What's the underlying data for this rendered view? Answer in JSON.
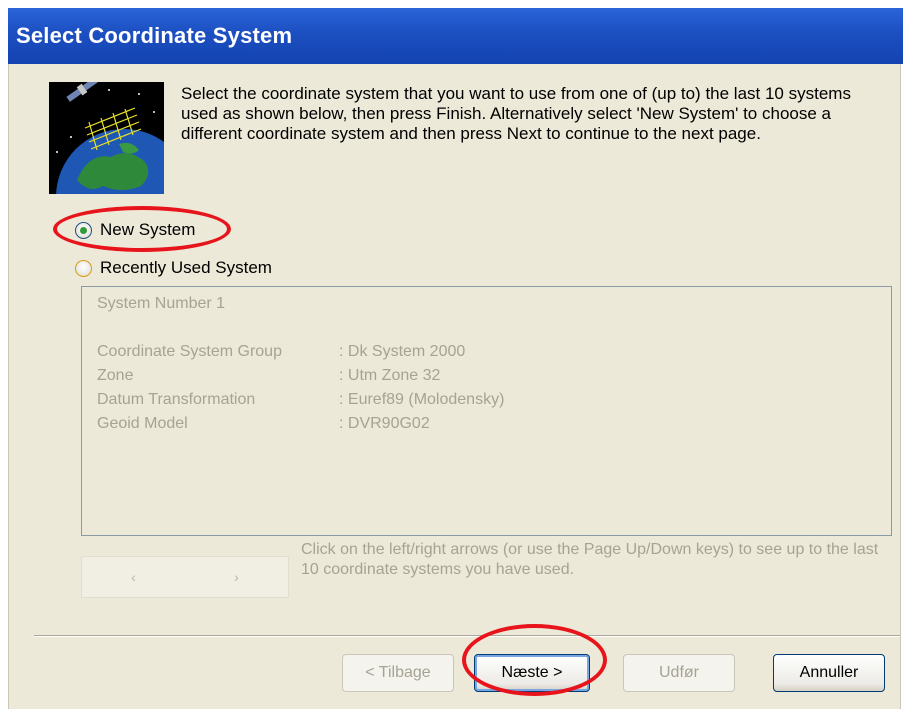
{
  "dialog": {
    "title": "Select Coordinate System",
    "intro": "Select the coordinate system that you want to use from one of (up to) the last 10 systems used as shown below, then press Finish. Alternatively select 'New System' to choose a different coordinate system and then press Next to continue to the next page.",
    "options": {
      "new_system": {
        "label": "New System",
        "selected": true
      },
      "recent_system": {
        "label": "Recently Used System",
        "selected": false
      }
    },
    "recent": {
      "system_number": "System Number 1",
      "rows": [
        {
          "key": "Coordinate System Group",
          "value": ": Dk System 2000"
        },
        {
          "key": "Zone",
          "value": ": Utm Zone 32"
        },
        {
          "key": "Datum Transformation",
          "value": ": Euref89  (Molodensky)"
        },
        {
          "key": "Geoid Model",
          "value": ": DVR90G02"
        }
      ],
      "nav_left": "‹",
      "nav_right": "›",
      "hint": "Click on the left/right arrows (or use the Page Up/Down keys) to see up to the last 10 coordinate systems you have used."
    },
    "buttons": {
      "back": "< Tilbage",
      "next": "Næste >",
      "finish": "Udfør",
      "cancel": "Annuller"
    }
  },
  "colors": {
    "titlebar": "#1c4fc1",
    "body_bg": "#ece9d8",
    "disabled_text": "#a6a393",
    "highlight_ring": "#e8141b",
    "radio_selected": "#2f9b3c"
  },
  "icons": {
    "header": "globe-satellite-icon",
    "radio_on": "radio-selected-icon",
    "radio_off": "radio-unselected-icon"
  }
}
